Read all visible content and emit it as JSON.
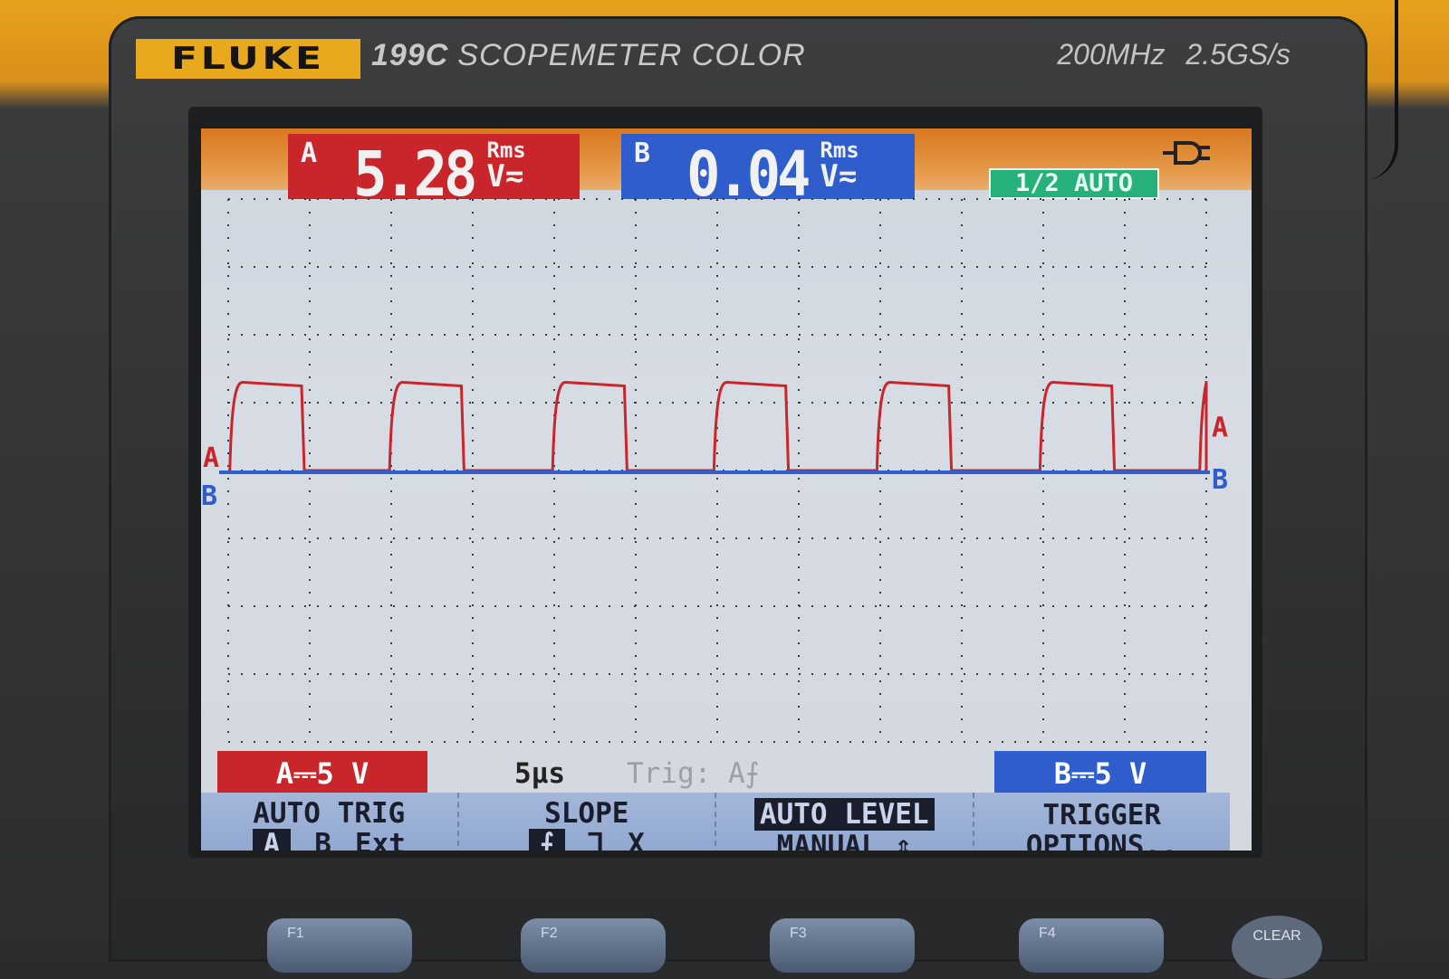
{
  "device": {
    "brand": "FLUKE",
    "model_number": "199C",
    "model_name": "SCOPEMETER COLOR",
    "bandwidth": "200MHz",
    "sample_rate": "2.5GS/s"
  },
  "readouts": {
    "a": {
      "channel": "A",
      "value": "5.28",
      "rms": "Rms",
      "unit": "V≂"
    },
    "b": {
      "channel": "B",
      "value": "0.04",
      "rms": "Rms",
      "unit": "V≂"
    },
    "mode_badge": "1/2 AUTO"
  },
  "markers": {
    "a": "A",
    "b": "B"
  },
  "status": {
    "a_scale": "A⎓5 V",
    "b_scale": "B⎓5 V",
    "timebase": "5µs",
    "trigger": "Trig: A⨍"
  },
  "softkeys": {
    "f1": {
      "title": "AUTO TRIG",
      "options": [
        "A",
        "B",
        "Ext"
      ]
    },
    "f2": {
      "title": "SLOPE",
      "options": [
        "⨍",
        "Ꞁ",
        "X"
      ]
    },
    "f3": {
      "line1": "AUTO LEVEL",
      "line2": "MANUAL ⇕"
    },
    "f4": {
      "line1": "TRIGGER",
      "line2": "OPTIONS.."
    }
  },
  "function_keys": [
    "F1",
    "F2",
    "F3",
    "F4"
  ],
  "clear_key": "CLEAR",
  "colors": {
    "channel_a": "#c8262a",
    "channel_b": "#2f5dcc",
    "softkey_bg": "#9aaed5",
    "holster": "#e2a020"
  },
  "chart_data": {
    "type": "line",
    "x_unit": "µs",
    "xlim": [
      0,
      60
    ],
    "ylim": [
      -20,
      20
    ],
    "x_divisions": 12,
    "y_divisions": 8,
    "series": [
      {
        "name": "A",
        "color": "#c8262a",
        "pulse_high_v": 6.5,
        "pulse_low_v": 0,
        "period_us": 10,
        "high_time_us": 4.4,
        "pulse_starts_us": [
          0.1,
          9.9,
          19.9,
          29.8,
          39.8,
          49.8,
          59.6
        ]
      },
      {
        "name": "B",
        "color": "#2f5dcc",
        "level_v": 0
      }
    ]
  }
}
